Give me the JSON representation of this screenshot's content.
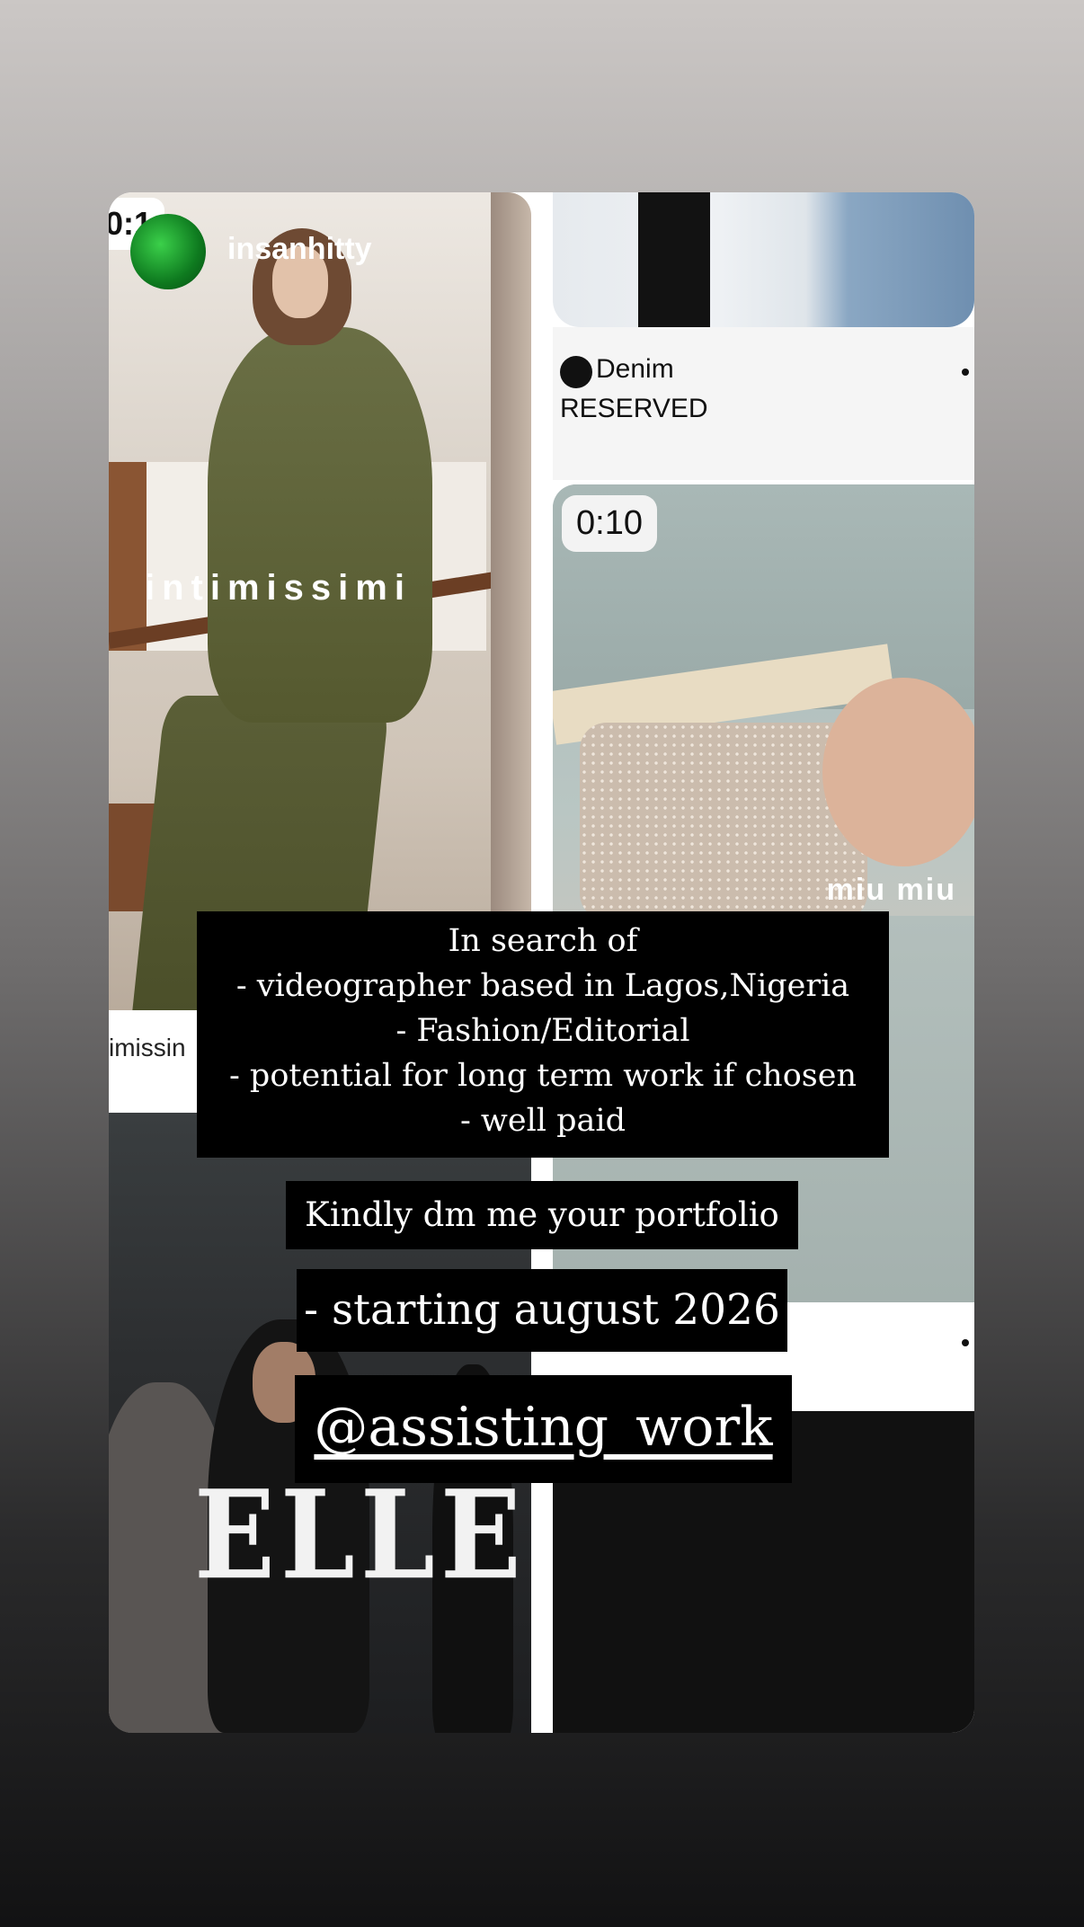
{
  "story": {
    "username": "insanhitty"
  },
  "tiles": {
    "left_top": {
      "timer": "0:1",
      "brand": "intimissimi",
      "caption_partial": "imissin"
    },
    "right_top": {
      "title": "Denim",
      "subtitle": "RESERVED"
    },
    "right_middle": {
      "timer": "0:10",
      "brand": "miu miu"
    },
    "left_bottom": {
      "brand": "ELLE"
    }
  },
  "overlay": {
    "lines": [
      "In search of",
      "- videographer based in Lagos,Nigeria",
      "- Fashion/Editorial",
      "- potential for long term work if chosen",
      "- well paid"
    ],
    "dm": "Kindly dm me your portfolio",
    "start": "- starting august 2026",
    "handle": "@assisting_work"
  }
}
